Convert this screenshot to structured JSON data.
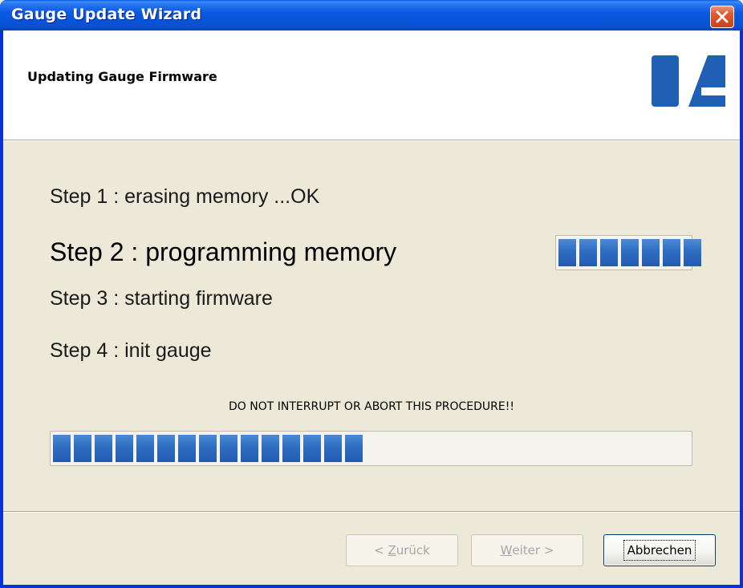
{
  "window": {
    "title": "Gauge Update Wizard",
    "close_icon": "close-icon",
    "title_color": "#ffffff",
    "titlebar_color": "#0a55e0"
  },
  "header": {
    "title": "Updating Gauge Firmware",
    "logo_icon": "brand-logo-icon",
    "logo_color": "#1f5fb4"
  },
  "steps": [
    {
      "label": "Step 1 : erasing memory ...OK",
      "status": "done"
    },
    {
      "label": "Step 2 : programming memory",
      "status": "active",
      "progress_blocks": 7,
      "progress_fraction": 1.0
    },
    {
      "label": "Step 3 : starting firmware",
      "status": "pending"
    },
    {
      "label": "Step 4 : init gauge",
      "status": "pending"
    }
  ],
  "warning": "DO NOT INTERRUPT OR ABORT THIS PROCEDURE!!",
  "overall_progress": {
    "blocks_filled": 15,
    "fraction": 0.49,
    "bar_color": "#2e6dc1"
  },
  "buttons": {
    "back": {
      "prefix": "< ",
      "mnemonic": "Z",
      "rest": "urück",
      "enabled": false
    },
    "next": {
      "mnemonic": "W",
      "rest": "eiter >",
      "enabled": false
    },
    "cancel": {
      "label": "Abbrechen",
      "enabled": true
    }
  }
}
